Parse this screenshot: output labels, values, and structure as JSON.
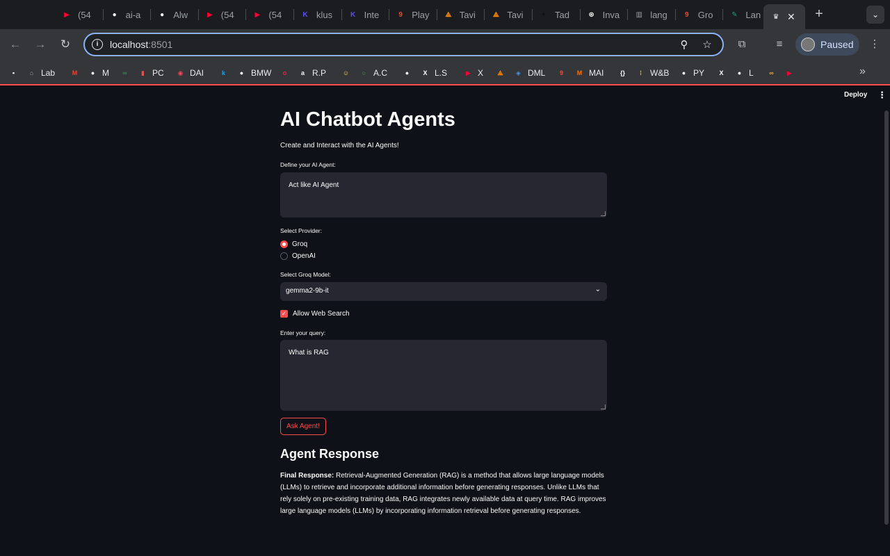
{
  "browser": {
    "tabs": [
      {
        "title": "(54",
        "favicon": "youtube-icon",
        "color": "#ff0033"
      },
      {
        "title": "ai-a",
        "favicon": "github-icon",
        "color": "#ffffff"
      },
      {
        "title": "Alw",
        "favicon": "github-icon",
        "color": "#ffffff"
      },
      {
        "title": "(54",
        "favicon": "youtube-icon",
        "color": "#ff0033"
      },
      {
        "title": "(54",
        "favicon": "youtube-icon",
        "color": "#ff0033"
      },
      {
        "title": "klus",
        "favicon": "klu-icon",
        "color": "#5b4cff"
      },
      {
        "title": "Inte",
        "favicon": "klu-icon",
        "color": "#5b4cff"
      },
      {
        "title": "Play",
        "favicon": "nine-icon",
        "color": "#e34f3a"
      },
      {
        "title": "Tavi",
        "favicon": "tavily-icon",
        "color": "#ff8a00"
      },
      {
        "title": "Tavi",
        "favicon": "tavily-icon",
        "color": "#ff8a00"
      },
      {
        "title": "Tad",
        "favicon": "wand-icon",
        "color": "#111111"
      },
      {
        "title": "Inva",
        "favicon": "openai-icon",
        "color": "#ffffff"
      },
      {
        "title": "lang",
        "favicon": "book-icon",
        "color": "#9aa0a6"
      },
      {
        "title": "Gro",
        "favicon": "nine-icon",
        "color": "#e34f3a"
      },
      {
        "title": "Lan",
        "favicon": "feather-icon",
        "color": "#1aa37a"
      }
    ],
    "active_tab_favicon": "streamlit-crown-icon",
    "address": {
      "host": "localhost",
      "port": ":8501"
    },
    "profile_label": "Paused",
    "bookmarks": [
      {
        "label": "",
        "icon": "notion-icon",
        "color": "#ffffff"
      },
      {
        "label": "Lab",
        "icon": "lab-icon",
        "color": "#9aa0a6"
      },
      {
        "label": "",
        "icon": "gmail-icon",
        "color": "#ea4335"
      },
      {
        "label": "M",
        "icon": "github-icon",
        "color": "#ffffff"
      },
      {
        "label": "",
        "icon": "gfg-icon",
        "color": "#2f8d46"
      },
      {
        "label": "PC",
        "icon": "bars-icon",
        "color": "#d9534f"
      },
      {
        "label": "DAI",
        "icon": "dai-icon",
        "color": "#e84a5f"
      },
      {
        "label": "",
        "icon": "k-icon",
        "color": "#1a9fe0"
      },
      {
        "label": "BMW",
        "icon": "github-icon",
        "color": "#ffffff"
      },
      {
        "label": "",
        "icon": "o-icon",
        "color": "#e0234e"
      },
      {
        "label": "R.P",
        "icon": "amazon-icon",
        "color": "#ffffff"
      },
      {
        "label": "",
        "icon": "huggingface-icon",
        "color": "#ffcc4d"
      },
      {
        "label": "A.C",
        "icon": "circle-icon",
        "color": "#3fb950"
      },
      {
        "label": "",
        "icon": "github-icon",
        "color": "#ffffff"
      },
      {
        "label": "L.S",
        "icon": "x-icon",
        "color": "#ffffff"
      },
      {
        "label": "X",
        "icon": "youtube-icon",
        "color": "#ff0033"
      },
      {
        "label": "",
        "icon": "tavily-icon",
        "color": "#ff8a00"
      },
      {
        "label": "DML",
        "icon": "dml-icon",
        "color": "#4a90e2"
      },
      {
        "label": "",
        "icon": "nine-icon",
        "color": "#e34f3a"
      },
      {
        "label": "MAI",
        "icon": "mistral-icon",
        "color": "#ff7000"
      },
      {
        "label": "",
        "icon": "braces-icon",
        "color": "#ffffff"
      },
      {
        "label": "W&B",
        "icon": "wandb-icon",
        "color": "#ffbe00"
      },
      {
        "label": "PY",
        "icon": "github-icon",
        "color": "#ffffff"
      },
      {
        "label": "",
        "icon": "x-icon",
        "color": "#ffffff"
      },
      {
        "label": "L",
        "icon": "github-icon",
        "color": "#ffffff"
      },
      {
        "label": "",
        "icon": "infinity-icon",
        "color": "#f5a623"
      },
      {
        "label": "",
        "icon": "youtube-icon",
        "color": "#ff0033"
      }
    ]
  },
  "app": {
    "deploy_label": "Deploy",
    "title": "AI Chatbot Agents",
    "subtitle": "Create and Interact with the AI Agents!",
    "agent_label": "Define your AI Agent:",
    "agent_value": "Act like AI Agent",
    "provider_label": "Select Provider:",
    "providers": [
      {
        "label": "Groq",
        "selected": true
      },
      {
        "label": "OpenAI",
        "selected": false
      }
    ],
    "model_label": "Select Groq Model:",
    "model_value": "gemma2-9b-it",
    "web_search_label": "Allow Web Search",
    "web_search_checked": true,
    "query_label": "Enter your query:",
    "query_value": "What is RAG",
    "ask_button": "Ask Agent!",
    "response_heading": "Agent Response",
    "response_prefix": "Final Response:",
    "response_text": " Retrieval-Augmented Generation (RAG) is a method that allows large language models (LLMs) to retrieve and incorporate additional information before generating responses. Unlike LLMs that rely solely on pre-existing training data, RAG integrates newly available data at query time. RAG improves large language models (LLMs) by incorporating information retrieval before generating responses.",
    "accent_color": "#ff4b4b"
  }
}
